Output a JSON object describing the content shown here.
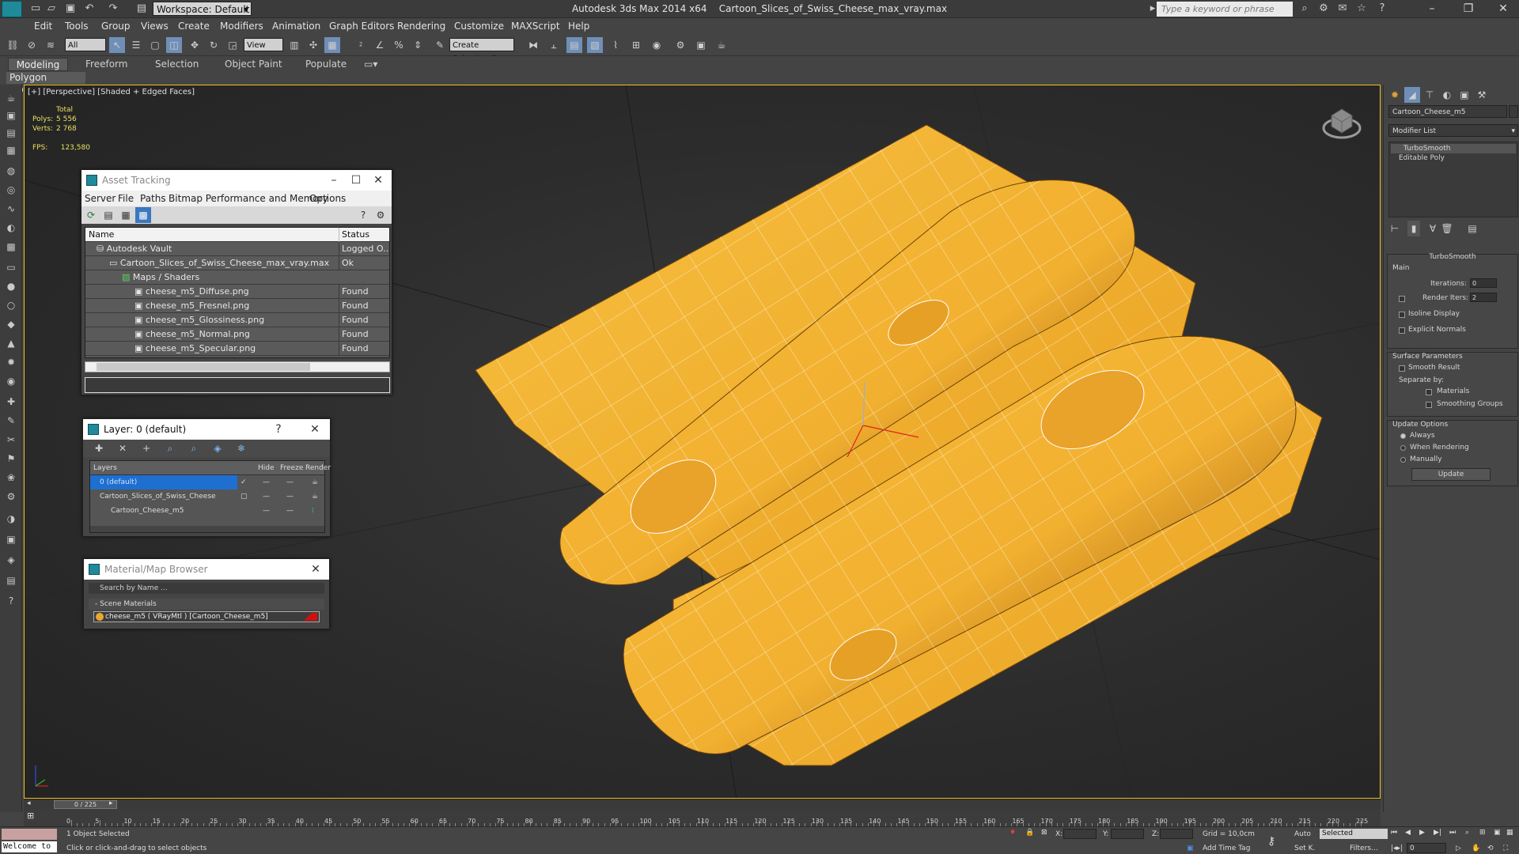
{
  "titlebar": {
    "workspace": "Workspace: Default",
    "app_title": "Autodesk 3ds Max  2014 x64",
    "file_title": "Cartoon_Slices_of_Swiss_Cheese_max_vray.max",
    "search_placeholder": "Type a keyword or phrase"
  },
  "menu": [
    "Edit",
    "Tools",
    "Group",
    "Views",
    "Create",
    "Modifiers",
    "Animation",
    "Graph Editors",
    "Rendering",
    "Customize",
    "MAXScript",
    "Help"
  ],
  "toolbar": {
    "filter_select": "All",
    "view_select": "View",
    "named_selection": "Create Selection Se"
  },
  "ribbon": {
    "tabs": [
      "Modeling",
      "Freeform",
      "Selection",
      "Object Paint",
      "Populate"
    ],
    "active_tab": "Modeling",
    "panel_label": "Polygon Modeling"
  },
  "viewport": {
    "label": "[+] [Perspective] [Shaded + Edged Faces]",
    "stats_total": "Total",
    "polys_label": "Polys:",
    "polys_value": "5 556",
    "verts_label": "Verts:",
    "verts_value": "2 768",
    "fps_label": "FPS:",
    "fps_value": "123,580"
  },
  "asset_tracking": {
    "title": "Asset Tracking",
    "menu": [
      "Server",
      "File",
      "Paths",
      "Bitmap Performance and Memory",
      "Options"
    ],
    "col_name": "Name",
    "col_status": "Status",
    "rows": [
      {
        "name": "Autodesk Vault",
        "status": "Logged O..."
      },
      {
        "name": "Cartoon_Slices_of_Swiss_Cheese_max_vray.max",
        "status": "Ok"
      },
      {
        "name": "Maps / Shaders",
        "status": ""
      },
      {
        "name": "cheese_m5_Diffuse.png",
        "status": "Found"
      },
      {
        "name": "cheese_m5_Fresnel.png",
        "status": "Found"
      },
      {
        "name": "cheese_m5_Glossiness.png",
        "status": "Found"
      },
      {
        "name": "cheese_m5_Normal.png",
        "status": "Found"
      },
      {
        "name": "cheese_m5_Specular.png",
        "status": "Found"
      }
    ]
  },
  "layer_window": {
    "title": "Layer: 0 (default)",
    "help": "?",
    "col_layers": "Layers",
    "col_hide": "Hide",
    "col_freeze": "Freeze",
    "col_render": "Render",
    "rows": [
      {
        "name": "0 (default)"
      },
      {
        "name": "Cartoon_Slices_of_Swiss_Cheese"
      },
      {
        "name": "Cartoon_Cheese_m5"
      }
    ]
  },
  "material_browser": {
    "title": "Material/Map Browser",
    "search_placeholder": "Search by Name ...",
    "category": "- Scene Materials",
    "item": "cheese_m5  ( VRayMtl )  [Cartoon_Cheese_m5]"
  },
  "command_panel": {
    "object_name": "Cartoon_Cheese_m5",
    "modifier_list": "Modifier List",
    "stack": [
      "TurboSmooth",
      "Editable Poly"
    ],
    "rollout_title": "TurboSmooth",
    "main_label": "Main",
    "iterations_label": "Iterations:",
    "iterations_value": "0",
    "render_iters_label": "Render Iters:",
    "render_iters_value": "2",
    "isoline": "Isoline Display",
    "explicit": "Explicit Normals",
    "surface_params": "Surface Parameters",
    "smooth_result": "Smooth Result",
    "separate_by": "Separate by:",
    "materials": "Materials",
    "smoothing_groups": "Smoothing Groups",
    "update_options": "Update Options",
    "always": "Always",
    "when_rendering": "When Rendering",
    "manually": "Manually",
    "update_button": "Update"
  },
  "timeline": {
    "frame": "0 / 225",
    "ticks": [
      "0",
      "5",
      "10",
      "15",
      "20",
      "25",
      "30",
      "35",
      "40",
      "45",
      "50",
      "55",
      "60",
      "65",
      "70",
      "75",
      "80",
      "85",
      "90",
      "95",
      "100",
      "105",
      "110",
      "115",
      "120",
      "125",
      "130",
      "135",
      "140",
      "145",
      "150",
      "155",
      "160",
      "165",
      "170",
      "175",
      "180",
      "185",
      "190",
      "195",
      "200",
      "205",
      "210",
      "215",
      "220",
      "225"
    ]
  },
  "status": {
    "welcome": "Welcome to",
    "selected": "1 Object Selected",
    "prompt": "Click or click-and-drag to select objects",
    "x_label": "X:",
    "y_label": "Y:",
    "z_label": "Z:",
    "grid": "Grid = 10,0cm",
    "add_time_tag": "Add Time Tag",
    "auto": "Auto",
    "selected_select": "Selected",
    "setk": "Set K.",
    "filters": "Filters...",
    "frame_value": "0"
  },
  "colors": {
    "cheese": "#f5b132",
    "cheese_dark": "#c7821a",
    "wire": "#ffffff",
    "viewport_border": "#f0c020"
  }
}
